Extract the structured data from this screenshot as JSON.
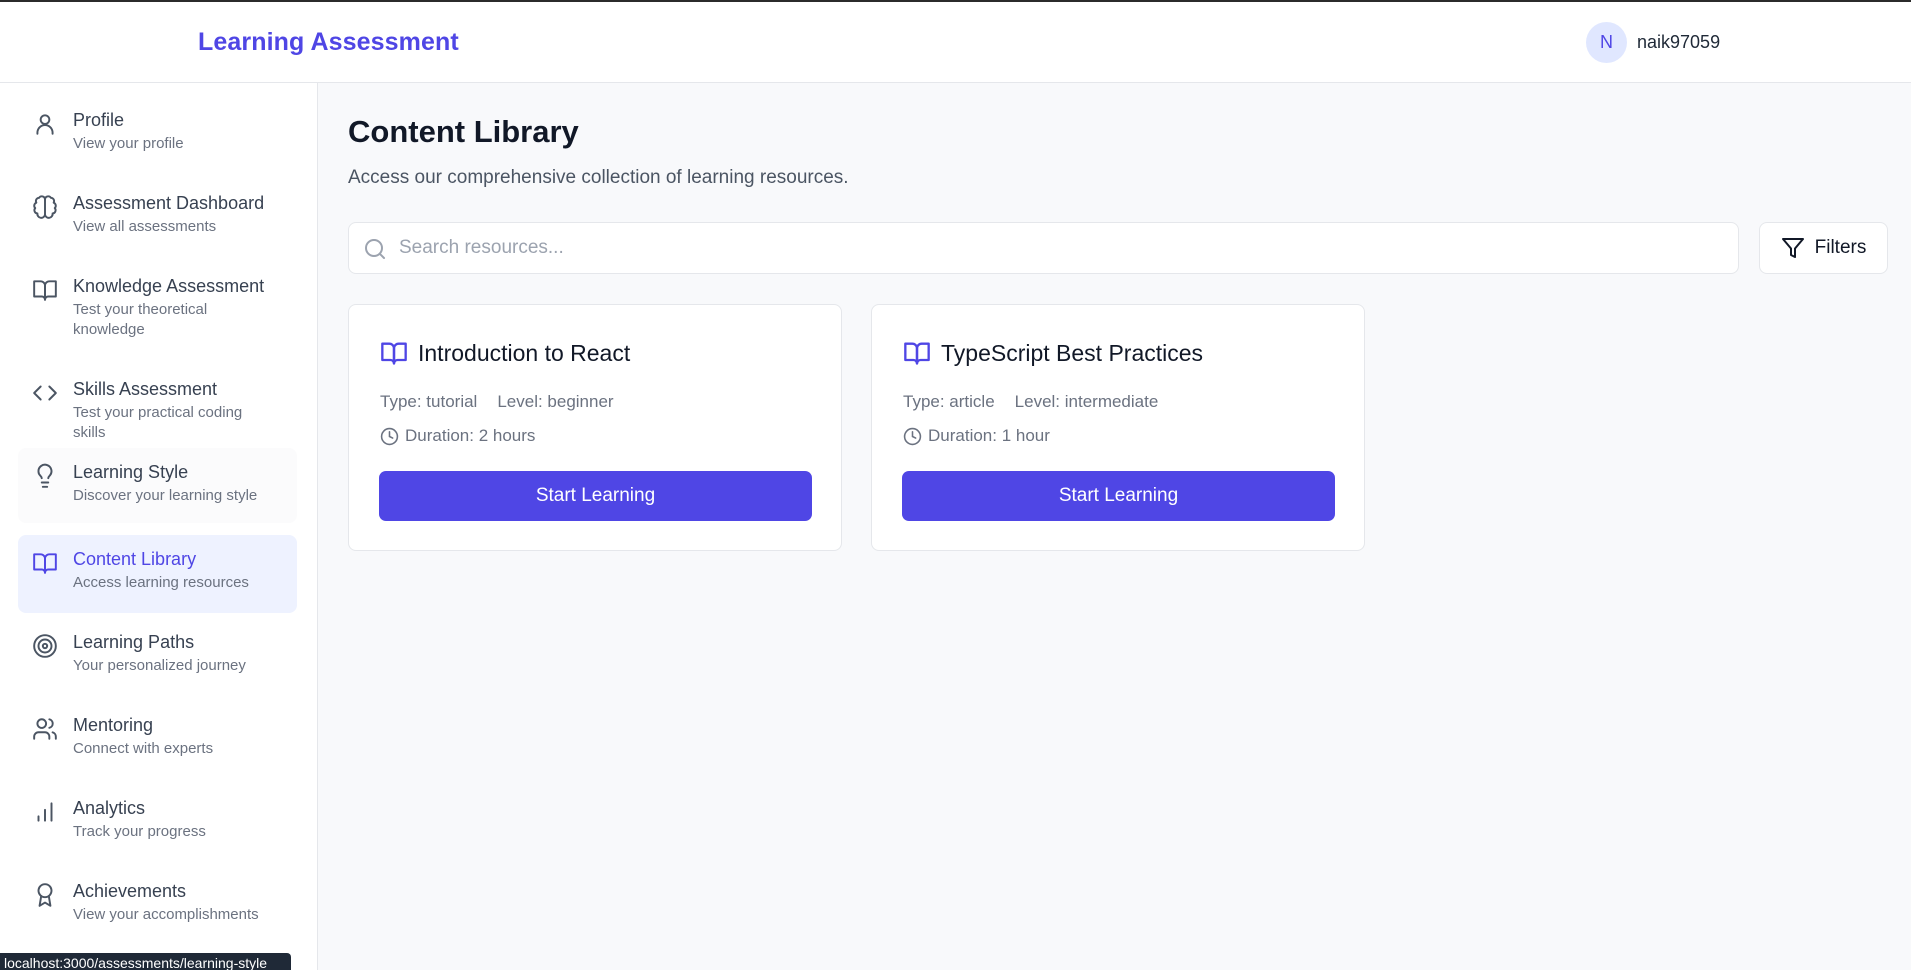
{
  "app": {
    "title": "Learning Assessment"
  },
  "user": {
    "initial": "N",
    "name": "naik97059"
  },
  "sidebar": {
    "items": [
      {
        "label": "Profile",
        "subtitle": "View your profile",
        "icon": "user-icon"
      },
      {
        "label": "Assessment Dashboard",
        "subtitle": "View all assessments",
        "icon": "brain-icon"
      },
      {
        "label": "Knowledge Assessment",
        "subtitle": "Test your theoretical knowledge",
        "icon": "book-open-icon"
      },
      {
        "label": "Skills Assessment",
        "subtitle": "Test your practical coding skills",
        "icon": "code-icon"
      },
      {
        "label": "Learning Style",
        "subtitle": "Discover your learning style",
        "icon": "lightbulb-icon"
      },
      {
        "label": "Content Library",
        "subtitle": "Access learning resources",
        "icon": "book-open-icon",
        "active": true
      },
      {
        "label": "Learning Paths",
        "subtitle": "Your personalized journey",
        "icon": "target-icon"
      },
      {
        "label": "Mentoring",
        "subtitle": "Connect with experts",
        "icon": "users-icon"
      },
      {
        "label": "Analytics",
        "subtitle": "Track your progress",
        "icon": "bar-chart-icon"
      },
      {
        "label": "Achievements",
        "subtitle": "View your accomplishments",
        "icon": "award-icon"
      }
    ]
  },
  "status_bar": {
    "url": "localhost:3000/assessments/learning-style"
  },
  "main": {
    "title": "Content Library",
    "description": "Access our comprehensive collection of learning resources.",
    "search": {
      "placeholder": "Search resources...",
      "value": ""
    },
    "filters_label": "Filters",
    "cards": [
      {
        "title": "Introduction to React",
        "type": "Type: tutorial",
        "level": "Level: beginner",
        "duration": "Duration: 2 hours",
        "button": "Start Learning"
      },
      {
        "title": "TypeScript Best Practices",
        "type": "Type: article",
        "level": "Level: intermediate",
        "duration": "Duration: 1 hour",
        "button": "Start Learning"
      }
    ]
  },
  "colors": {
    "accent": "#4f46e5",
    "accent_light": "#eef2ff",
    "background": "#f8f9fb"
  }
}
